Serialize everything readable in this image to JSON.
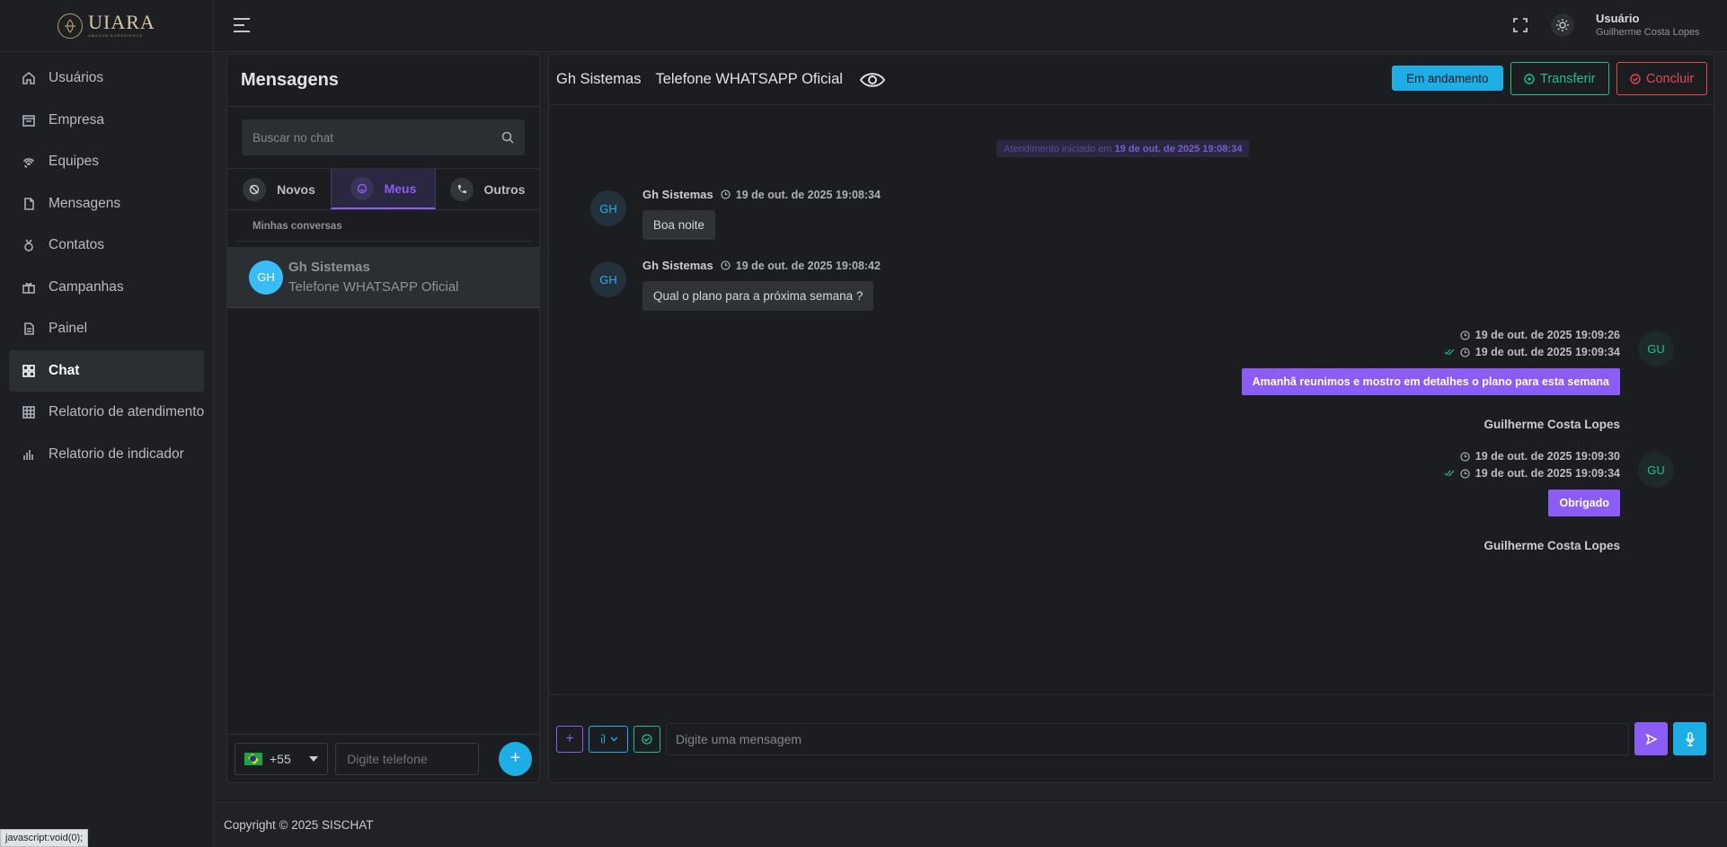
{
  "sidebar": {
    "logo": "UIARA",
    "logo_sub": "AMAZON EXPERIENCE",
    "items": [
      {
        "label": "Usuários",
        "icon": "home-icon"
      },
      {
        "label": "Empresa",
        "icon": "building-icon"
      },
      {
        "label": "Equipes",
        "icon": "fingerprint-icon"
      },
      {
        "label": "Mensagens",
        "icon": "file-icon"
      },
      {
        "label": "Contatos",
        "icon": "medal-icon"
      },
      {
        "label": "Campanhas",
        "icon": "gift-icon"
      },
      {
        "label": "Painel",
        "icon": "document-icon"
      },
      {
        "label": "Chat",
        "icon": "grid-icon",
        "active": true
      },
      {
        "label": "Relatorio de atendimento",
        "icon": "table-icon"
      },
      {
        "label": "Relatorio de indicador",
        "icon": "bar-chart-icon"
      }
    ]
  },
  "topbar": {
    "user_label": "Usuário",
    "user_name": "Guilherme Costa Lopes"
  },
  "messages_panel": {
    "title": "Mensagens",
    "search_placeholder": "Buscar no chat",
    "tabs": [
      {
        "label": "Novos"
      },
      {
        "label": "Meus",
        "active": true
      },
      {
        "label": "Outros"
      }
    ],
    "section_label": "Minhas conversas",
    "conversations": [
      {
        "initials": "GH",
        "name": "Gh Sistemas",
        "channel": "Telefone WHATSAPP Oficial"
      }
    ],
    "dial_code": "+55",
    "phone_placeholder": "Digite telefone",
    "add_label": "+"
  },
  "chat": {
    "contact": "Gh Sistemas",
    "channel": "Telefone WHATSAPP Oficial",
    "status_label": "Em andamento",
    "transfer_label": "Transferir",
    "finish_label": "Concluir",
    "started_prefix": "Atendimento iniciado em",
    "started_date": "19 de out. de 2025 19:08:34",
    "incoming": [
      {
        "initials": "GH",
        "sender": "Gh Sistemas",
        "time": "19 de out. de 2025 19:08:34",
        "text": "Boa noite"
      },
      {
        "initials": "GH",
        "sender": "Gh Sistemas",
        "time": "19 de out. de 2025 19:08:42",
        "text": "Qual o plano para a próxima semana ?"
      }
    ],
    "outgoing": [
      {
        "initials": "GU",
        "time_sent": "19 de out. de 2025 19:09:26",
        "time_read": "19 de out. de 2025 19:09:34",
        "text": "Amanhã reunimos e mostro em detalhes o plano para esta semana",
        "author": "Guilherme Costa Lopes"
      },
      {
        "initials": "GU",
        "time_sent": "19 de out. de 2025 19:09:30",
        "time_read": "19 de out. de 2025 19:09:34",
        "text": "Obrigado",
        "author": "Guilherme Costa Lopes"
      }
    ],
    "composer_placeholder": "Digite uma mensagem"
  },
  "footer": {
    "copyright": "Copyright © 2025 SISCHAT"
  },
  "status_bar": "javascript:void(0);"
}
